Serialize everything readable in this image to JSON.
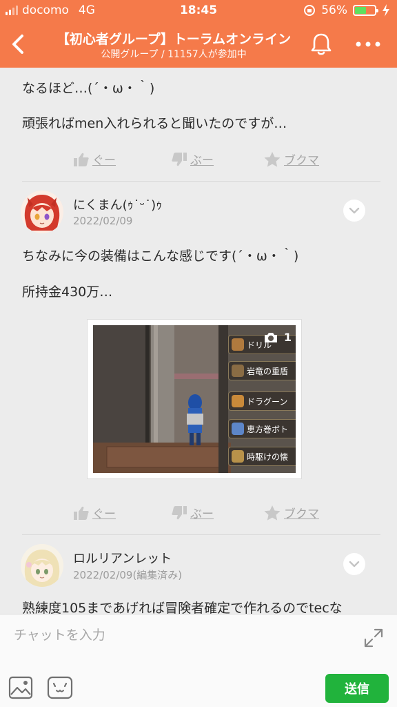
{
  "status": {
    "carrier": "docomo",
    "network": "4G",
    "time": "18:45",
    "battery": "56%",
    "battery_level": 0.56
  },
  "header": {
    "title": "【初心者グループ】トーラムオンライン",
    "subtitle": "公開グループ / 11157人が参加中"
  },
  "messages": [
    {
      "lines": [
        "なるほど…(´・ω・｀)",
        "頑張ればmen入れられると聞いたのですが…"
      ],
      "reactions": [
        "ぐー",
        "ぶー",
        "ブクマ"
      ]
    },
    {
      "username": "にくまん(ｩ˙ᵕ˙)ｩ",
      "date": "2022/02/09",
      "lines": [
        "ちなみに今の装備はこんな感じです(´・ω・｀)",
        "所持金430万…"
      ],
      "image": {
        "count": "1",
        "menu_items": [
          "ドリル",
          "岩竜の重盾",
          "ドラグーン",
          "恵方巻ボト",
          "時駆けの懐"
        ]
      },
      "reactions": [
        "ぐー",
        "ぶー",
        "ブクマ"
      ]
    },
    {
      "username": "ロルリアンレット",
      "date": "2022/02/09(編集済み)",
      "lines": [
        "熟練度105まであげれば冒険者確定で作れるのでtecな"
      ]
    }
  ],
  "chat": {
    "placeholder": "チャットを入力",
    "send_label": "送信"
  },
  "colors": {
    "header_bg": "#f57a4a",
    "send_button": "#21b33c"
  }
}
